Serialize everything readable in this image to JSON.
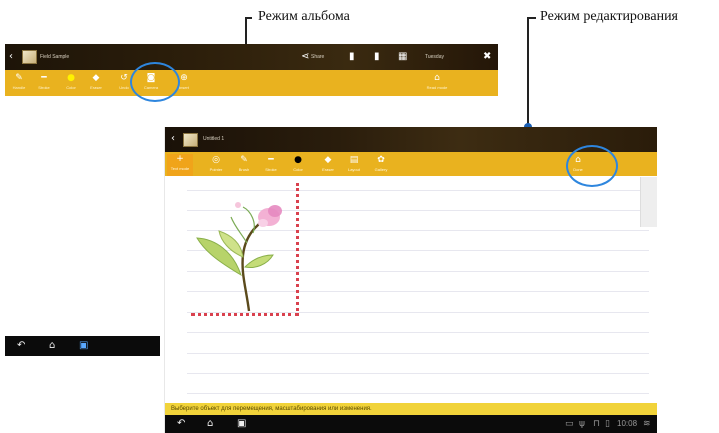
{
  "callouts": {
    "album_mode": "Режим альбома",
    "edit_mode": "Режим редактирования"
  },
  "colors": {
    "toolbar": "#e9b21f",
    "highlight_ring": "#2e86de",
    "selection_border": "#d9414e",
    "status_strip": "#f1d33a"
  },
  "album_screen": {
    "title": "Field Sample",
    "top_actions": [
      "share-icon",
      "page-icon",
      "page-icon",
      "grid-icon",
      "trash-icon"
    ],
    "share_label": "Share",
    "date_label": "Tuesday",
    "toolbar_items": [
      {
        "label": "Handle",
        "icon": "handle-icon"
      },
      {
        "label": "Stroke",
        "icon": "stroke-icon"
      },
      {
        "label": "Color",
        "icon": "color-dot-icon"
      },
      {
        "label": "Eraser",
        "icon": "eraser-icon"
      },
      {
        "label": "Undo",
        "icon": "undo-icon"
      },
      {
        "label": "Camera",
        "icon": "camera-icon"
      },
      {
        "label": "Insert",
        "icon": "insert-icon"
      },
      {
        "label": "Read mode",
        "icon": "read-mode-icon"
      }
    ]
  },
  "edit_screen": {
    "title": "Untitled 1",
    "toolbar_items": [
      {
        "label": "Text mode",
        "icon": "plus-icon"
      },
      {
        "label": "Pointer",
        "icon": "pointer-icon"
      },
      {
        "label": "Brush",
        "icon": "brush-icon"
      },
      {
        "label": "Stroke",
        "icon": "stroke-icon"
      },
      {
        "label": "Color",
        "icon": "color-dot-icon"
      },
      {
        "label": "Eraser",
        "icon": "eraser-icon"
      },
      {
        "label": "Layout",
        "icon": "layout-icon"
      },
      {
        "label": "Gallery",
        "icon": "gallery-icon"
      },
      {
        "label": "Done",
        "icon": "done-icon"
      }
    ],
    "status_hint": "Выберите объект для перемещения, масштабирования или изменения.",
    "clock": "10:08",
    "system_icons": [
      "back-icon",
      "home-icon",
      "recent-apps-icon"
    ]
  }
}
